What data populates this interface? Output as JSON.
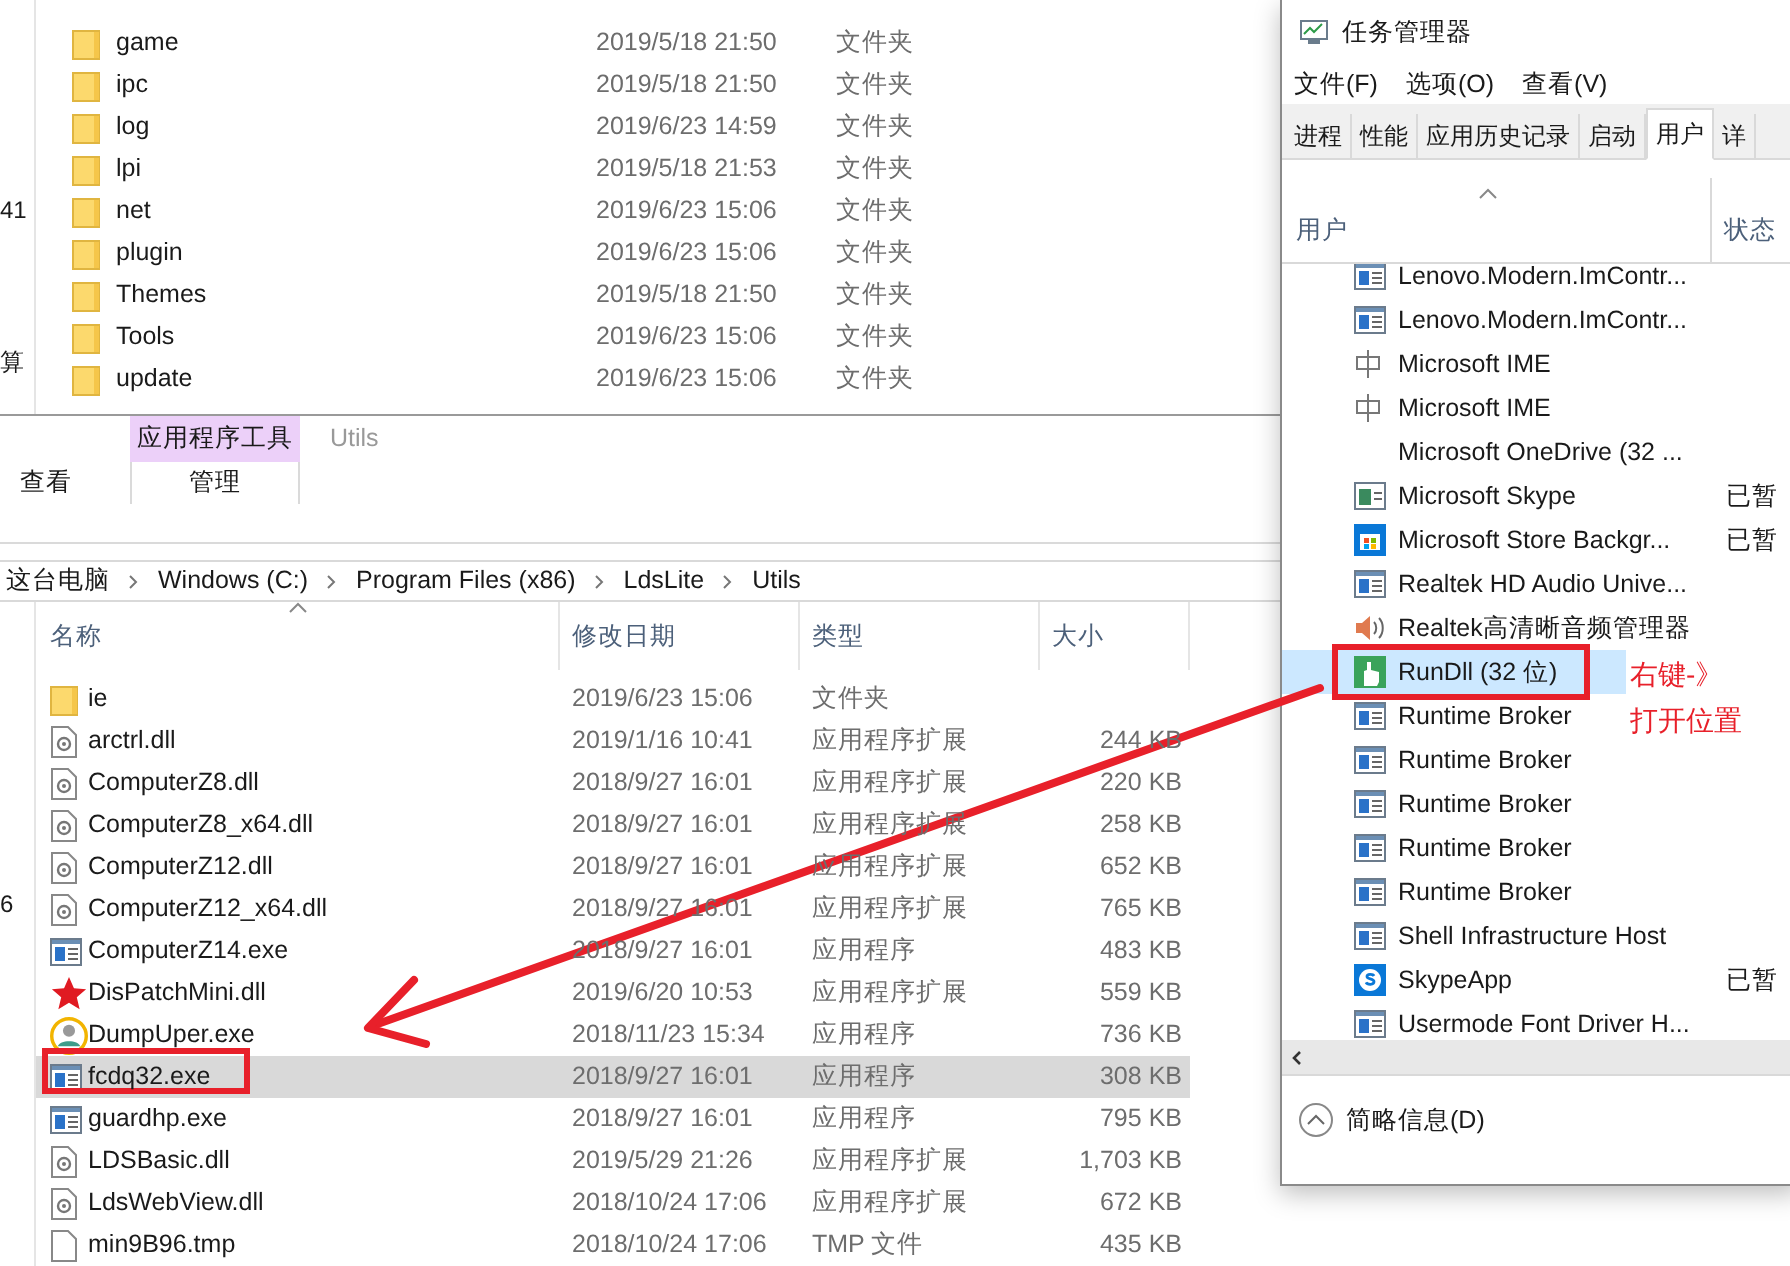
{
  "back_explorer": {
    "nav_fragments": [
      "41",
      "算"
    ],
    "rows": [
      {
        "name": "game",
        "date": "2019/5/18 21:50",
        "type": "文件夹"
      },
      {
        "name": "ipc",
        "date": "2019/5/18 21:50",
        "type": "文件夹"
      },
      {
        "name": "log",
        "date": "2019/6/23 14:59",
        "type": "文件夹"
      },
      {
        "name": "lpi",
        "date": "2019/5/18 21:53",
        "type": "文件夹"
      },
      {
        "name": "net",
        "date": "2019/6/23 15:06",
        "type": "文件夹"
      },
      {
        "name": "plugin",
        "date": "2019/6/23 15:06",
        "type": "文件夹"
      },
      {
        "name": "Themes",
        "date": "2019/5/18 21:50",
        "type": "文件夹"
      },
      {
        "name": "Tools",
        "date": "2019/6/23 15:06",
        "type": "文件夹"
      },
      {
        "name": "update",
        "date": "2019/6/23 15:06",
        "type": "文件夹"
      }
    ]
  },
  "explorer": {
    "context_tab": "应用程序工具",
    "title": "Utils",
    "ribbon_tabs": [
      {
        "label": "查看",
        "selected": false
      },
      {
        "label": "管理",
        "selected": true
      }
    ],
    "breadcrumb": [
      "这台电脑",
      "Windows (C:)",
      "Program Files (x86)",
      "LdsLite",
      "Utils"
    ],
    "nav_fragment": "6",
    "columns": [
      "名称",
      "修改日期",
      "类型",
      "大小"
    ],
    "rows": [
      {
        "name": "ie",
        "date": "2019/6/23 15:06",
        "type": "文件夹",
        "size": "",
        "kind": "folder",
        "selected": false
      },
      {
        "name": "arctrl.dll",
        "date": "2019/1/16 10:41",
        "type": "应用程序扩展",
        "size": "244 KB",
        "kind": "dll",
        "selected": false
      },
      {
        "name": "ComputerZ8.dll",
        "date": "2018/9/27 16:01",
        "type": "应用程序扩展",
        "size": "220 KB",
        "kind": "dll",
        "selected": false
      },
      {
        "name": "ComputerZ8_x64.dll",
        "date": "2018/9/27 16:01",
        "type": "应用程序扩展",
        "size": "258 KB",
        "kind": "dll",
        "selected": false
      },
      {
        "name": "ComputerZ12.dll",
        "date": "2018/9/27 16:01",
        "type": "应用程序扩展",
        "size": "652 KB",
        "kind": "dll",
        "selected": false
      },
      {
        "name": "ComputerZ12_x64.dll",
        "date": "2018/9/27 16:01",
        "type": "应用程序扩展",
        "size": "765 KB",
        "kind": "dll",
        "selected": false
      },
      {
        "name": "ComputerZ14.exe",
        "date": "2018/9/27 16:01",
        "type": "应用程序",
        "size": "483 KB",
        "kind": "exe",
        "selected": false
      },
      {
        "name": "DisPatchMini.dll",
        "date": "2019/6/20 10:53",
        "type": "应用程序扩展",
        "size": "559 KB",
        "kind": "star",
        "selected": false
      },
      {
        "name": "DumpUper.exe",
        "date": "2018/11/23 15:34",
        "type": "应用程序",
        "size": "736 KB",
        "kind": "avatar",
        "selected": false
      },
      {
        "name": "fcdq32.exe",
        "date": "2018/9/27 16:01",
        "type": "应用程序",
        "size": "308 KB",
        "kind": "exe",
        "selected": true
      },
      {
        "name": "guardhp.exe",
        "date": "2018/9/27 16:01",
        "type": "应用程序",
        "size": "795 KB",
        "kind": "exe",
        "selected": false
      },
      {
        "name": "LDSBasic.dll",
        "date": "2019/5/29 21:26",
        "type": "应用程序扩展",
        "size": "1,703 KB",
        "kind": "dll",
        "selected": false
      },
      {
        "name": "LdsWebView.dll",
        "date": "2018/10/24 17:06",
        "type": "应用程序扩展",
        "size": "672 KB",
        "kind": "dll",
        "selected": false
      },
      {
        "name": "min9B96.tmp",
        "date": "2018/10/24 17:06",
        "type": "TMP 文件",
        "size": "435 KB",
        "kind": "file",
        "selected": false
      }
    ]
  },
  "task_manager": {
    "title": "任务管理器",
    "menu": [
      "文件(F)",
      "选项(O)",
      "查看(V)"
    ],
    "tabs": [
      {
        "label": "进程",
        "selected": false
      },
      {
        "label": "性能",
        "selected": false
      },
      {
        "label": "应用历史记录",
        "selected": false
      },
      {
        "label": "启动",
        "selected": false
      },
      {
        "label": "用户",
        "selected": true
      },
      {
        "label": "详",
        "selected": false
      }
    ],
    "columns": [
      "用户",
      "状态"
    ],
    "rows": [
      {
        "name": "Lenovo.Modern.ImContr...",
        "status": "",
        "kind": "app",
        "selected": false
      },
      {
        "name": "Lenovo.Modern.ImContr...",
        "status": "",
        "kind": "app",
        "selected": false
      },
      {
        "name": "Microsoft IME",
        "status": "",
        "kind": "ime",
        "selected": false
      },
      {
        "name": "Microsoft IME",
        "status": "",
        "kind": "ime",
        "selected": false
      },
      {
        "name": "Microsoft OneDrive (32 ...",
        "status": "",
        "kind": "none",
        "selected": false
      },
      {
        "name": "Microsoft Skype",
        "status": "已暂",
        "kind": "app-green",
        "selected": false
      },
      {
        "name": "Microsoft Store Backgr...",
        "status": "已暂",
        "kind": "store",
        "selected": false
      },
      {
        "name": "Realtek HD Audio Unive...",
        "status": "",
        "kind": "app",
        "selected": false
      },
      {
        "name": "Realtek高清晰音频管理器",
        "status": "",
        "kind": "speaker",
        "selected": false
      },
      {
        "name": "RunDll (32 位)",
        "status": "",
        "kind": "hand",
        "selected": true
      },
      {
        "name": "Runtime Broker",
        "status": "",
        "kind": "app",
        "selected": false
      },
      {
        "name": "Runtime Broker",
        "status": "",
        "kind": "app",
        "selected": false
      },
      {
        "name": "Runtime Broker",
        "status": "",
        "kind": "app",
        "selected": false
      },
      {
        "name": "Runtime Broker",
        "status": "",
        "kind": "app",
        "selected": false
      },
      {
        "name": "Runtime Broker",
        "status": "",
        "kind": "app",
        "selected": false
      },
      {
        "name": "Shell Infrastructure Host",
        "status": "",
        "kind": "app",
        "selected": false
      },
      {
        "name": "SkypeApp",
        "status": "已暂",
        "kind": "skype",
        "selected": false
      },
      {
        "name": "Usermode Font Driver H...",
        "status": "",
        "kind": "app",
        "selected": false
      }
    ],
    "footer": "简略信息(D)"
  },
  "annotation": [
    "右键-》",
    "打开位置"
  ]
}
